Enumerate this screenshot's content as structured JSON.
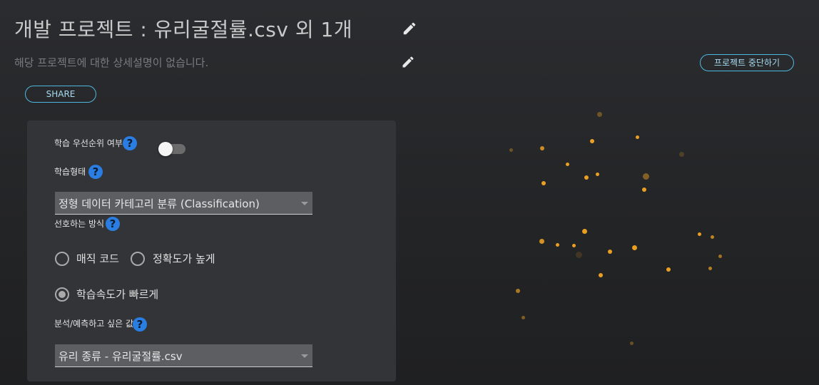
{
  "header": {
    "title": "개발 프로젝트 : 유리굴절률.csv 외 1개",
    "description": "해당 프로젝트에 대한 상세설명이 없습니다.",
    "share_label": "SHARE",
    "stop_label": "프로젝트 중단하기"
  },
  "form": {
    "priority_label": "학습 우선순위 여부",
    "priority_enabled": false,
    "training_type_label": "학습형태",
    "training_type_value": "정형 데이터 카테고리 분류 (Classification)",
    "preference_label": "선호하는 방식",
    "options": [
      {
        "label": "매직 코드",
        "selected": false
      },
      {
        "label": "정확도가 높게",
        "selected": false
      },
      {
        "label": "학습속도가 빠르게",
        "selected": true
      }
    ],
    "target_label": "분석/예측하고 싶은 값",
    "target_value": "유리 종류 - 유리굴절률.csv",
    "help_glyph": "?"
  },
  "colors": {
    "accent_outline": "#4fb8e0",
    "help_icon": "#2a7de1",
    "particle": "#f5a623"
  }
}
